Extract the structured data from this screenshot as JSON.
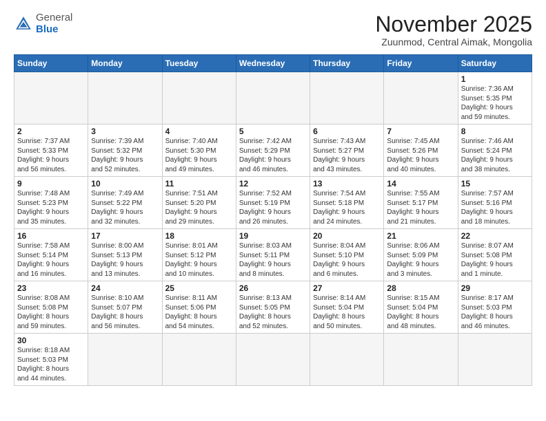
{
  "header": {
    "logo_general": "General",
    "logo_blue": "Blue",
    "month": "November 2025",
    "location": "Zuunmod, Central Aimak, Mongolia"
  },
  "weekdays": [
    "Sunday",
    "Monday",
    "Tuesday",
    "Wednesday",
    "Thursday",
    "Friday",
    "Saturday"
  ],
  "weeks": [
    [
      {
        "day": "",
        "info": ""
      },
      {
        "day": "",
        "info": ""
      },
      {
        "day": "",
        "info": ""
      },
      {
        "day": "",
        "info": ""
      },
      {
        "day": "",
        "info": ""
      },
      {
        "day": "",
        "info": ""
      },
      {
        "day": "1",
        "info": "Sunrise: 7:36 AM\nSunset: 5:35 PM\nDaylight: 9 hours\nand 59 minutes."
      }
    ],
    [
      {
        "day": "2",
        "info": "Sunrise: 7:37 AM\nSunset: 5:33 PM\nDaylight: 9 hours\nand 56 minutes."
      },
      {
        "day": "3",
        "info": "Sunrise: 7:39 AM\nSunset: 5:32 PM\nDaylight: 9 hours\nand 52 minutes."
      },
      {
        "day": "4",
        "info": "Sunrise: 7:40 AM\nSunset: 5:30 PM\nDaylight: 9 hours\nand 49 minutes."
      },
      {
        "day": "5",
        "info": "Sunrise: 7:42 AM\nSunset: 5:29 PM\nDaylight: 9 hours\nand 46 minutes."
      },
      {
        "day": "6",
        "info": "Sunrise: 7:43 AM\nSunset: 5:27 PM\nDaylight: 9 hours\nand 43 minutes."
      },
      {
        "day": "7",
        "info": "Sunrise: 7:45 AM\nSunset: 5:26 PM\nDaylight: 9 hours\nand 40 minutes."
      },
      {
        "day": "8",
        "info": "Sunrise: 7:46 AM\nSunset: 5:24 PM\nDaylight: 9 hours\nand 38 minutes."
      }
    ],
    [
      {
        "day": "9",
        "info": "Sunrise: 7:48 AM\nSunset: 5:23 PM\nDaylight: 9 hours\nand 35 minutes."
      },
      {
        "day": "10",
        "info": "Sunrise: 7:49 AM\nSunset: 5:22 PM\nDaylight: 9 hours\nand 32 minutes."
      },
      {
        "day": "11",
        "info": "Sunrise: 7:51 AM\nSunset: 5:20 PM\nDaylight: 9 hours\nand 29 minutes."
      },
      {
        "day": "12",
        "info": "Sunrise: 7:52 AM\nSunset: 5:19 PM\nDaylight: 9 hours\nand 26 minutes."
      },
      {
        "day": "13",
        "info": "Sunrise: 7:54 AM\nSunset: 5:18 PM\nDaylight: 9 hours\nand 24 minutes."
      },
      {
        "day": "14",
        "info": "Sunrise: 7:55 AM\nSunset: 5:17 PM\nDaylight: 9 hours\nand 21 minutes."
      },
      {
        "day": "15",
        "info": "Sunrise: 7:57 AM\nSunset: 5:16 PM\nDaylight: 9 hours\nand 18 minutes."
      }
    ],
    [
      {
        "day": "16",
        "info": "Sunrise: 7:58 AM\nSunset: 5:14 PM\nDaylight: 9 hours\nand 16 minutes."
      },
      {
        "day": "17",
        "info": "Sunrise: 8:00 AM\nSunset: 5:13 PM\nDaylight: 9 hours\nand 13 minutes."
      },
      {
        "day": "18",
        "info": "Sunrise: 8:01 AM\nSunset: 5:12 PM\nDaylight: 9 hours\nand 10 minutes."
      },
      {
        "day": "19",
        "info": "Sunrise: 8:03 AM\nSunset: 5:11 PM\nDaylight: 9 hours\nand 8 minutes."
      },
      {
        "day": "20",
        "info": "Sunrise: 8:04 AM\nSunset: 5:10 PM\nDaylight: 9 hours\nand 6 minutes."
      },
      {
        "day": "21",
        "info": "Sunrise: 8:06 AM\nSunset: 5:09 PM\nDaylight: 9 hours\nand 3 minutes."
      },
      {
        "day": "22",
        "info": "Sunrise: 8:07 AM\nSunset: 5:08 PM\nDaylight: 9 hours\nand 1 minute."
      }
    ],
    [
      {
        "day": "23",
        "info": "Sunrise: 8:08 AM\nSunset: 5:08 PM\nDaylight: 8 hours\nand 59 minutes."
      },
      {
        "day": "24",
        "info": "Sunrise: 8:10 AM\nSunset: 5:07 PM\nDaylight: 8 hours\nand 56 minutes."
      },
      {
        "day": "25",
        "info": "Sunrise: 8:11 AM\nSunset: 5:06 PM\nDaylight: 8 hours\nand 54 minutes."
      },
      {
        "day": "26",
        "info": "Sunrise: 8:13 AM\nSunset: 5:05 PM\nDaylight: 8 hours\nand 52 minutes."
      },
      {
        "day": "27",
        "info": "Sunrise: 8:14 AM\nSunset: 5:04 PM\nDaylight: 8 hours\nand 50 minutes."
      },
      {
        "day": "28",
        "info": "Sunrise: 8:15 AM\nSunset: 5:04 PM\nDaylight: 8 hours\nand 48 minutes."
      },
      {
        "day": "29",
        "info": "Sunrise: 8:17 AM\nSunset: 5:03 PM\nDaylight: 8 hours\nand 46 minutes."
      }
    ],
    [
      {
        "day": "30",
        "info": "Sunrise: 8:18 AM\nSunset: 5:03 PM\nDaylight: 8 hours\nand 44 minutes."
      },
      {
        "day": "",
        "info": ""
      },
      {
        "day": "",
        "info": ""
      },
      {
        "day": "",
        "info": ""
      },
      {
        "day": "",
        "info": ""
      },
      {
        "day": "",
        "info": ""
      },
      {
        "day": "",
        "info": ""
      }
    ]
  ]
}
